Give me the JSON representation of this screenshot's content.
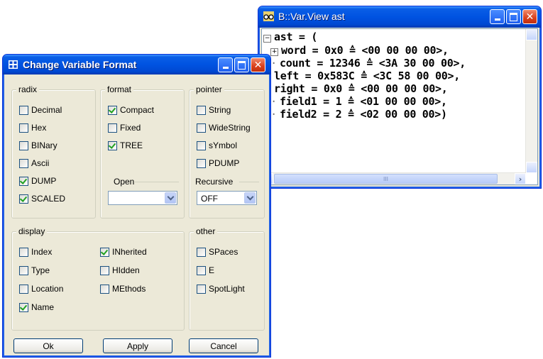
{
  "var_view": {
    "title": "B::Var.View ast",
    "lines": [
      {
        "marker": "minus",
        "text": "ast = ("
      },
      {
        "marker": "plus",
        "text": "word = 0x0 ≙ <00 00 00 00>,"
      },
      {
        "marker": "dot",
        "text": "count = 12346 ≙ <3A 30 00 00>,"
      },
      {
        "marker": "plus",
        "text": "left = 0x583C ≙ <3C 58 00 00>,"
      },
      {
        "marker": "plus",
        "text": "right = 0x0 ≙ <00 00 00 00>,"
      },
      {
        "marker": "dot",
        "text": "field1 = 1 ≙ <01 00 00 00>,"
      },
      {
        "marker": "dot",
        "text": "field2 = 2 ≙ <02 00 00 00>)"
      }
    ],
    "scroll_grip": "III"
  },
  "dialog": {
    "title": "Change Variable Format",
    "radix": {
      "legend": "radix",
      "items": [
        {
          "label": "Decimal",
          "checked": false
        },
        {
          "label": "Hex",
          "checked": false
        },
        {
          "label": "BINary",
          "checked": false
        },
        {
          "label": "Ascii",
          "checked": false
        },
        {
          "label": "DUMP",
          "checked": true
        },
        {
          "label": "SCALED",
          "checked": true
        }
      ]
    },
    "format": {
      "legend": "format",
      "items": [
        {
          "label": "Compact",
          "checked": true
        },
        {
          "label": "Fixed",
          "checked": false
        },
        {
          "label": "TREE",
          "checked": true
        }
      ],
      "open_label": "Open",
      "open_value": ""
    },
    "pointer": {
      "legend": "pointer",
      "items": [
        {
          "label": "String",
          "checked": false
        },
        {
          "label": "WideString",
          "checked": false
        },
        {
          "label": "sYmbol",
          "checked": false
        },
        {
          "label": "PDUMP",
          "checked": false
        }
      ],
      "recursive_label": "Recursive",
      "recursive_value": "OFF"
    },
    "display": {
      "legend": "display",
      "col1": [
        {
          "label": "Index",
          "checked": false
        },
        {
          "label": "Type",
          "checked": false
        },
        {
          "label": "Location",
          "checked": false
        },
        {
          "label": "Name",
          "checked": true
        }
      ],
      "col2": [
        {
          "label": "INherited",
          "checked": true
        },
        {
          "label": "HIdden",
          "checked": false
        },
        {
          "label": "MEthods",
          "checked": false
        }
      ]
    },
    "other": {
      "legend": "other",
      "items": [
        {
          "label": "SPaces",
          "checked": false
        },
        {
          "label": "E",
          "checked": false
        },
        {
          "label": "SpotLight",
          "checked": false
        }
      ]
    },
    "buttons": {
      "ok": "Ok",
      "apply": "Apply",
      "cancel": "Cancel"
    }
  }
}
